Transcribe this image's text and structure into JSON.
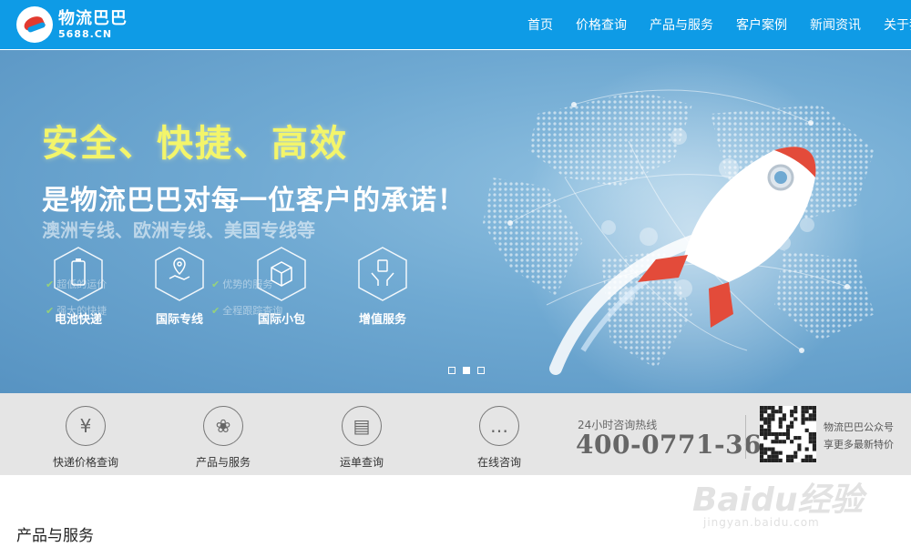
{
  "header": {
    "logo_cn": "物流巴巴",
    "logo_en": "5688.CN",
    "nav": [
      "首页",
      "价格查询",
      "产品与服务",
      "客户案例",
      "新闻资讯",
      "关于我们"
    ]
  },
  "banner": {
    "headline": "安全、快捷、高效",
    "subline": "是物流巴巴对每一位客户的承诺！",
    "routes": "澳洲专线、欧洲专线、美国专线等",
    "features": [
      {
        "label": "电池快递",
        "icon": "battery-icon"
      },
      {
        "label": "国际专线",
        "icon": "map-pin-icon"
      },
      {
        "label": "国际小包",
        "icon": "package-icon"
      },
      {
        "label": "增值服务",
        "icon": "hands-icon"
      }
    ],
    "ghost_texts": [
      "超低的运价",
      "优势的服务",
      "强大的快捷",
      "全程跟踪查询"
    ],
    "slides": 3,
    "active_slide": 2
  },
  "quickbar": {
    "items": [
      {
        "label": "快递价格查询",
        "icon": "yen-icon",
        "glyph": "¥"
      },
      {
        "label": "产品与服务",
        "icon": "grid-icon",
        "glyph": "❀"
      },
      {
        "label": "运单查询",
        "icon": "waybill-icon",
        "glyph": "▤"
      },
      {
        "label": "在线咨询",
        "icon": "chat-icon",
        "glyph": "…"
      }
    ],
    "hotline_label": "24小时咨询热线",
    "hotline_number": "400-0771-365",
    "wechat_line1": "物流巴巴公众号",
    "wechat_line2": "享更多最新特价"
  },
  "section": {
    "title": "产品与服务"
  },
  "watermark": {
    "main": "Baidu经验",
    "sub": "jingyan.baidu.com"
  },
  "colors": {
    "header_bg": "#0e9be6",
    "headline": "#f3f56a",
    "quickbar_bg": "#e5e5e5"
  }
}
